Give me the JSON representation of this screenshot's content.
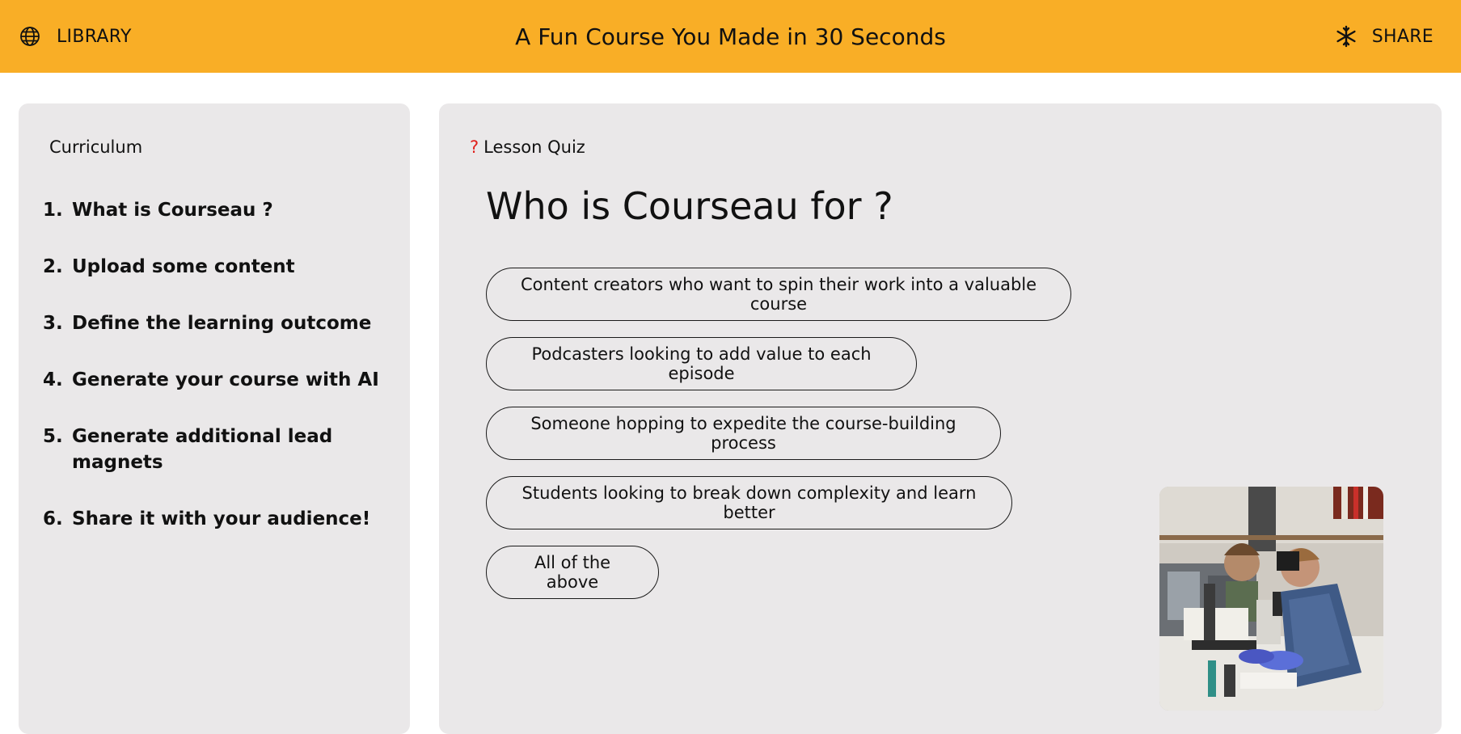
{
  "header": {
    "library_label": "LIBRARY",
    "library_icon": "globe-icon",
    "title": "A Fun Course You Made in 30 Seconds",
    "share_label": "SHARE",
    "share_icon": "snowflake-icon",
    "bg_color": "#f9ae26"
  },
  "sidebar": {
    "heading": "Curriculum",
    "items": [
      {
        "num": "1.",
        "label": "What is Courseau ?"
      },
      {
        "num": "2.",
        "label": "Upload some content"
      },
      {
        "num": "3.",
        "label": "Define the learning outcome"
      },
      {
        "num": "4.",
        "label": "Generate your course with AI"
      },
      {
        "num": "5.",
        "label": "Generate additional lead magnets"
      },
      {
        "num": "6.",
        "label": "Share it with your audience!"
      }
    ]
  },
  "quiz": {
    "tag_mark": "?",
    "tag_label": "Lesson Quiz",
    "question": "Who is Courseau for ?",
    "options": [
      "Content creators who want to spin their work into a valuable course",
      "Podcasters looking to add value to each episode",
      "Someone hopping to expedite the course-building process",
      "Students looking to break down complexity and learn better",
      "All of the above"
    ]
  },
  "video": {
    "description_icon": "video-thumbnail"
  }
}
